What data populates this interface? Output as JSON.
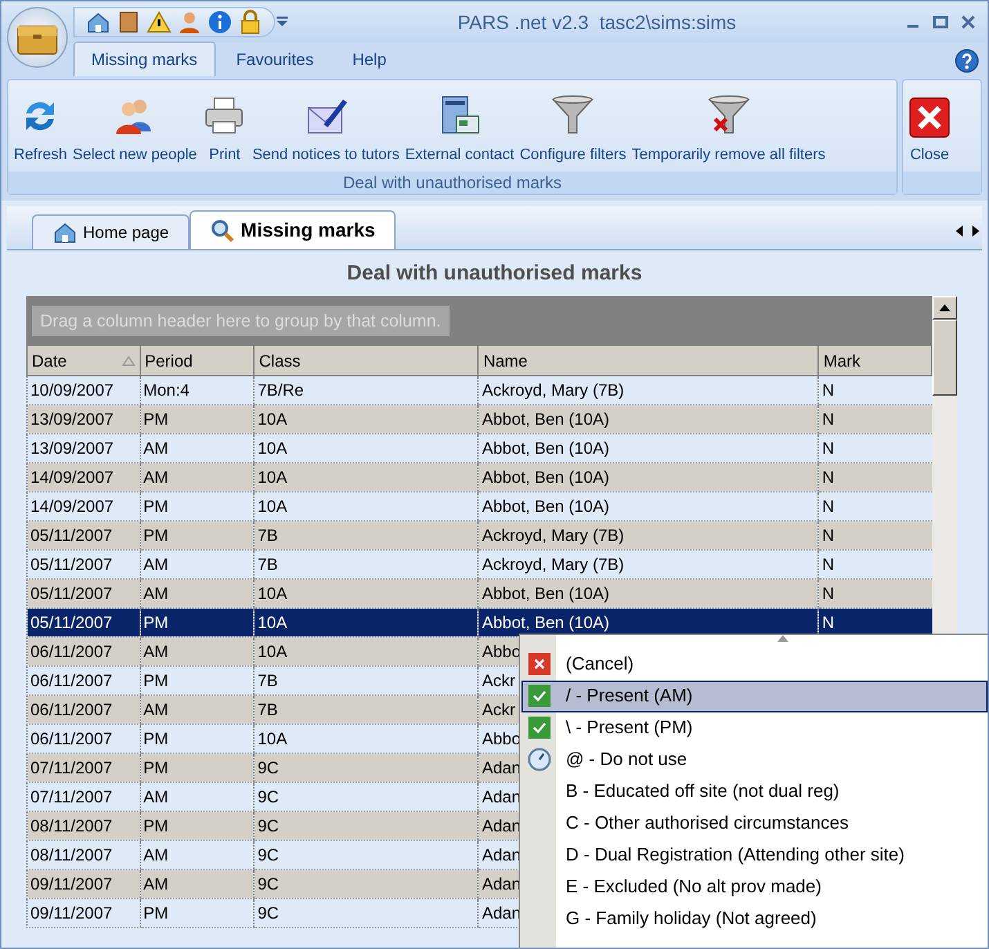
{
  "window": {
    "title": "PARS .net v2.3  tasc2\\sims:sims"
  },
  "quick_access": [
    {
      "kind": "home"
    },
    {
      "kind": "book"
    },
    {
      "kind": "warning"
    },
    {
      "kind": "person"
    },
    {
      "kind": "info"
    },
    {
      "kind": "lock"
    }
  ],
  "ribbon_tabs": [
    {
      "label": "Missing marks",
      "selected": true
    },
    {
      "label": "Favourites",
      "selected": false
    },
    {
      "label": "Help",
      "selected": false
    }
  ],
  "ribbon": {
    "group_label": "Deal with unauthorised marks",
    "buttons": [
      {
        "label": "Refresh",
        "kind": "refresh"
      },
      {
        "label": "Select new people",
        "kind": "people"
      },
      {
        "label": "Print",
        "kind": "print"
      },
      {
        "label": "Send notices to tutors",
        "kind": "mail"
      },
      {
        "label": "External contact",
        "kind": "contact"
      },
      {
        "label": "Configure filters",
        "kind": "filter"
      },
      {
        "label": "Temporarily remove all filters",
        "kind": "nofilter"
      }
    ],
    "close_button": "Close"
  },
  "doc_tabs": [
    {
      "label": "Home page",
      "kind": "home",
      "selected": false
    },
    {
      "label": "Missing marks",
      "kind": "search",
      "selected": true
    }
  ],
  "heading": "Deal with unauthorised marks",
  "grid": {
    "group_hint": "Drag a column header here to group by that column.",
    "columns": [
      {
        "label": "Date",
        "sorted": true
      },
      {
        "label": "Period"
      },
      {
        "label": "Class"
      },
      {
        "label": "Name"
      },
      {
        "label": "Mark"
      }
    ],
    "rows": [
      {
        "cells": [
          "10/09/2007",
          "Mon:4",
          "7B/Re",
          "Ackroyd, Mary (7B)",
          "N"
        ],
        "selected": false
      },
      {
        "cells": [
          "13/09/2007",
          "PM",
          "10A",
          "Abbot, Ben (10A)",
          "N"
        ],
        "selected": false
      },
      {
        "cells": [
          "13/09/2007",
          "AM",
          "10A",
          "Abbot, Ben (10A)",
          "N"
        ],
        "selected": false
      },
      {
        "cells": [
          "14/09/2007",
          "AM",
          "10A",
          "Abbot, Ben (10A)",
          "N"
        ],
        "selected": false
      },
      {
        "cells": [
          "14/09/2007",
          "PM",
          "10A",
          "Abbot, Ben (10A)",
          "N"
        ],
        "selected": false
      },
      {
        "cells": [
          "05/11/2007",
          "PM",
          "7B",
          "Ackroyd, Mary (7B)",
          "N"
        ],
        "selected": false
      },
      {
        "cells": [
          "05/11/2007",
          "AM",
          "7B",
          "Ackroyd, Mary (7B)",
          "N"
        ],
        "selected": false
      },
      {
        "cells": [
          "05/11/2007",
          "AM",
          "10A",
          "Abbot, Ben (10A)",
          "N"
        ],
        "selected": false
      },
      {
        "cells": [
          "05/11/2007",
          "PM",
          "10A",
          "Abbot, Ben (10A)",
          "N"
        ],
        "selected": true
      },
      {
        "cells": [
          "06/11/2007",
          "AM",
          "10A",
          "Abbo"
        ],
        "selected": false
      },
      {
        "cells": [
          "06/11/2007",
          "PM",
          "7B",
          "Ackr"
        ],
        "selected": false
      },
      {
        "cells": [
          "06/11/2007",
          "AM",
          "7B",
          "Ackr"
        ],
        "selected": false
      },
      {
        "cells": [
          "06/11/2007",
          "PM",
          "10A",
          "Abbo"
        ],
        "selected": false
      },
      {
        "cells": [
          "07/11/2007",
          "PM",
          "9C",
          "Adan"
        ],
        "selected": false
      },
      {
        "cells": [
          "07/11/2007",
          "AM",
          "9C",
          "Adan"
        ],
        "selected": false
      },
      {
        "cells": [
          "08/11/2007",
          "PM",
          "9C",
          "Adan"
        ],
        "selected": false
      },
      {
        "cells": [
          "08/11/2007",
          "AM",
          "9C",
          "Adan"
        ],
        "selected": false
      },
      {
        "cells": [
          "09/11/2007",
          "AM",
          "9C",
          "Adan"
        ],
        "selected": false
      },
      {
        "cells": [
          "09/11/2007",
          "PM",
          "9C",
          "Adan"
        ],
        "selected": false
      }
    ]
  },
  "mark_menu": {
    "items": [
      {
        "label": "(Cancel)",
        "kind": "cancel",
        "selected": false
      },
      {
        "label": "/ - Present (AM)",
        "kind": "present",
        "selected": true
      },
      {
        "label": "\\ - Present (PM)",
        "kind": "present",
        "selected": false
      },
      {
        "label": "@ - Do not use",
        "kind": "clock",
        "selected": false
      },
      {
        "label": "B - Educated off site (not dual reg)",
        "kind": "plain",
        "selected": false
      },
      {
        "label": "C - Other authorised circumstances",
        "kind": "plain",
        "selected": false
      },
      {
        "label": "D - Dual Registration (Attending other site)",
        "kind": "plain",
        "selected": false
      },
      {
        "label": "E - Excluded (No alt prov made)",
        "kind": "plain",
        "selected": false
      },
      {
        "label": "G - Family holiday (Not agreed)",
        "kind": "plain",
        "selected": false
      }
    ]
  }
}
